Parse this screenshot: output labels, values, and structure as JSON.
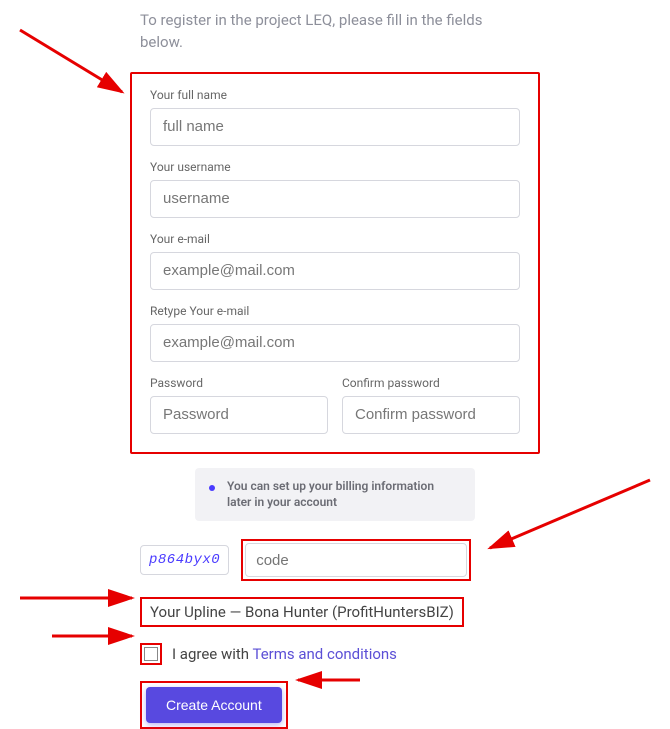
{
  "intro": "To register in the project LEQ, please fill in the fields below.",
  "fields": {
    "fullname": {
      "label": "Your full name",
      "placeholder": "full name"
    },
    "username": {
      "label": "Your username",
      "placeholder": "username"
    },
    "email": {
      "label": "Your e-mail",
      "placeholder": "example@mail.com"
    },
    "email2": {
      "label": "Retype Your e-mail",
      "placeholder": "example@mail.com"
    },
    "password": {
      "label": "Password",
      "placeholder": "Password"
    },
    "confirm": {
      "label": "Confirm password",
      "placeholder": "Confirm password"
    }
  },
  "info": "You can set up your billing information later in your account",
  "captcha": {
    "image_text": "p864byx0",
    "placeholder": "code"
  },
  "upline": "Your Upline — Bona Hunter (ProfitHuntersBIZ)",
  "agree": {
    "text": "I agree with ",
    "link": "Terms and conditions"
  },
  "submit": "Create Account"
}
